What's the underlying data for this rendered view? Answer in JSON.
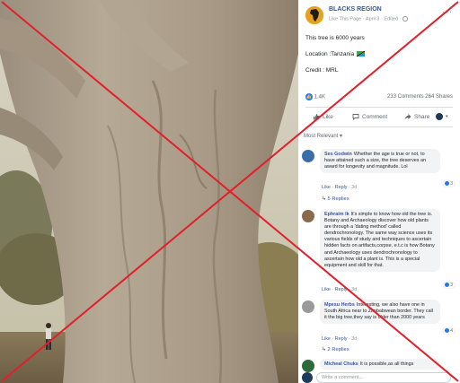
{
  "post": {
    "page_name": "BLACKS REGION",
    "meta_like_page": "Like This Page",
    "meta_dot1": "·",
    "meta_date": "April 3",
    "meta_dot2": "·",
    "meta_edited": "Edited",
    "meta_dot3": "·",
    "lines": [
      "This tree is 6000 years",
      "Location :Tanzania",
      "Credit : MRL"
    ]
  },
  "stats": {
    "likes": "1.4K",
    "comments": "233 Comments",
    "shares": "264 Shares"
  },
  "actions": {
    "like": "Like",
    "comment": "Comment",
    "share": "Share"
  },
  "sort_label": "Most Relevant ▾",
  "comments": [
    {
      "author": "Ses Godwin",
      "text": "Whether the age is true or not, to have attained such a size, the tree deserves an award for longevity and magnitude. Lol",
      "reactions": "3",
      "like": "Like",
      "reply": "Reply",
      "time": "3d",
      "replies": "5 Replies"
    },
    {
      "author": "Ephraim Ik",
      "text": "It's simple to know how old the tree is. Botany and Archaeology discover how old plants are through a 'dating method' called dendrochronology. The same way science uses its various fields of study and techniques to ascertain hidden facts on artifacts,corpse, e.t.c is how Botany and Archaeology uses dendrochronology to ascertain how old a plant is. This is a special equipment and skill for that.",
      "reactions": "3",
      "like": "Like",
      "reply": "Reply",
      "time": "3d"
    },
    {
      "author": "Mpesu Herbs",
      "text": "Interesting, we also have one in South Africa near to Zimbabwean border. They call it the big tree,they say is older than 2000 years",
      "reactions": "4",
      "like": "Like",
      "reply": "Reply",
      "time": "3d",
      "replies": "2 Replies"
    },
    {
      "author": "Micheal Chuks",
      "text": "It is possible,as all things"
    }
  ],
  "write_placeholder": "Write a comment...",
  "overlay_color": "#e0202a"
}
